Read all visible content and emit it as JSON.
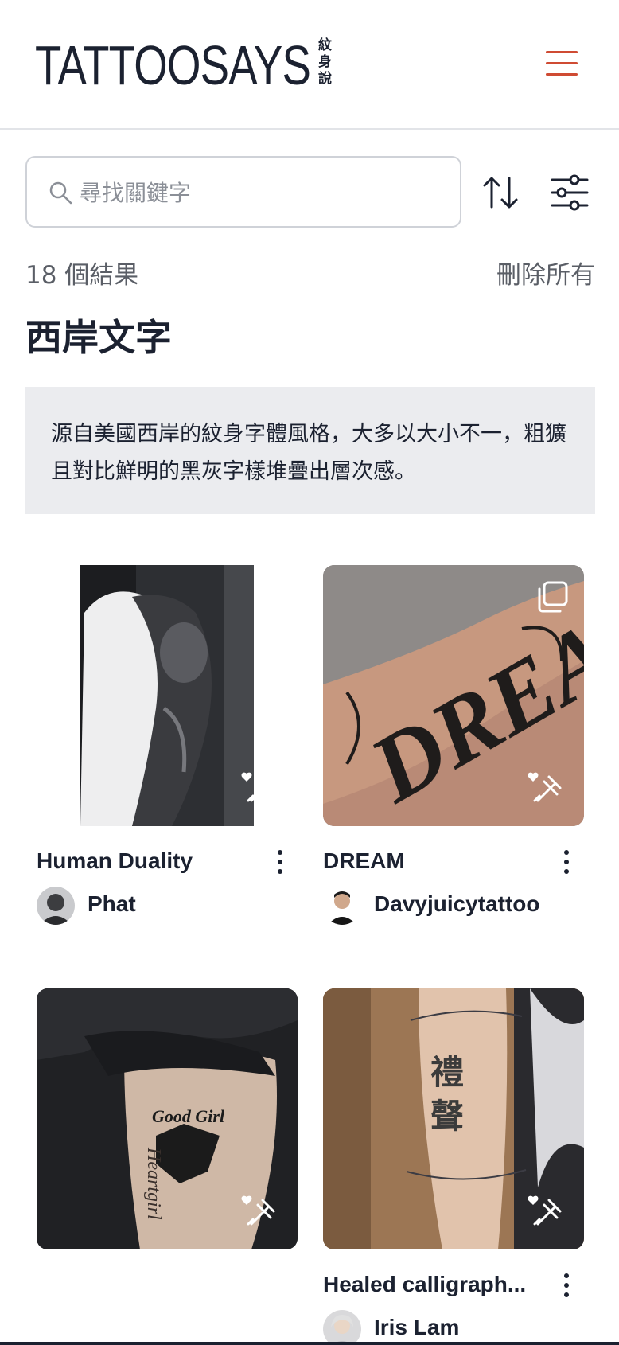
{
  "header": {
    "logo_text": "TATTOOSAYS",
    "logo_cjk": "紋身說",
    "menu_icon": "hamburger-menu-icon",
    "accent_color": "#cf4b33"
  },
  "search": {
    "placeholder": "尋找關鍵字",
    "value": ""
  },
  "results": {
    "count_label": "18 個結果",
    "clear_label": "刪除所有"
  },
  "page": {
    "title": "西岸文字",
    "description": "源自美國西岸的紋身字體風格，大多以大小不一，粗獷且對比鮮明的黑灰字樣堆疊出層次感。"
  },
  "cards": [
    {
      "title": "Human Duality",
      "artist": "Phat"
    },
    {
      "title": "DREAM",
      "artist": "Davyjuicytattoo"
    },
    {
      "title": "",
      "artist": ""
    },
    {
      "title": "Healed calligraph...",
      "artist": "Iris Lam"
    }
  ]
}
